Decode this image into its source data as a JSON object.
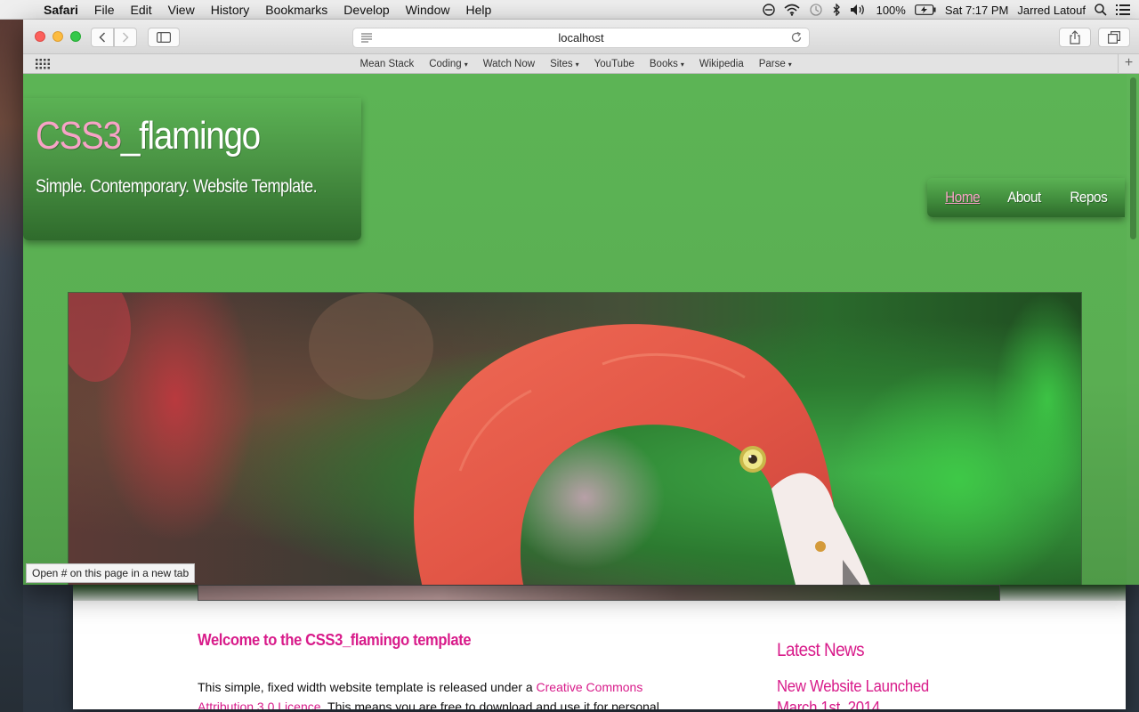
{
  "menubar": {
    "app": "Safari",
    "items": [
      "File",
      "Edit",
      "View",
      "History",
      "Bookmarks",
      "Develop",
      "Window",
      "Help"
    ],
    "battery": "100%",
    "clock": "Sat 7:17 PM",
    "user": "Jarred Latouf"
  },
  "browser": {
    "url": "localhost",
    "favorites": [
      {
        "label": "Mean Stack",
        "dropdown": false
      },
      {
        "label": "Coding",
        "dropdown": true
      },
      {
        "label": "Watch Now",
        "dropdown": false
      },
      {
        "label": "Sites",
        "dropdown": true
      },
      {
        "label": "YouTube",
        "dropdown": false
      },
      {
        "label": "Books",
        "dropdown": true
      },
      {
        "label": "Wikipedia",
        "dropdown": false
      },
      {
        "label": "Parse",
        "dropdown": true
      }
    ],
    "status_link": "Open # on this page in a new tab"
  },
  "site": {
    "title_accent": "CSS3",
    "title_rest": "_flamingo",
    "tagline": "Simple. Contemporary. Website Template.",
    "nav": [
      "Home",
      "About",
      "Repos"
    ],
    "accent_color": "#f7a3c6",
    "background_color": "#5aae52"
  },
  "background_page": {
    "heading": "Welcome to the CSS3_flamingo template",
    "intro_text": "This simple, fixed width website template is released under a",
    "intro_link": "Creative Commons",
    "second_line_link": "Attribution 3.0 Licence",
    "second_line_text": ". This means you are free to download and use it for personal",
    "news_title": "Latest News",
    "news_item": "New Website Launched",
    "news_date": "March 1st, 2014"
  }
}
